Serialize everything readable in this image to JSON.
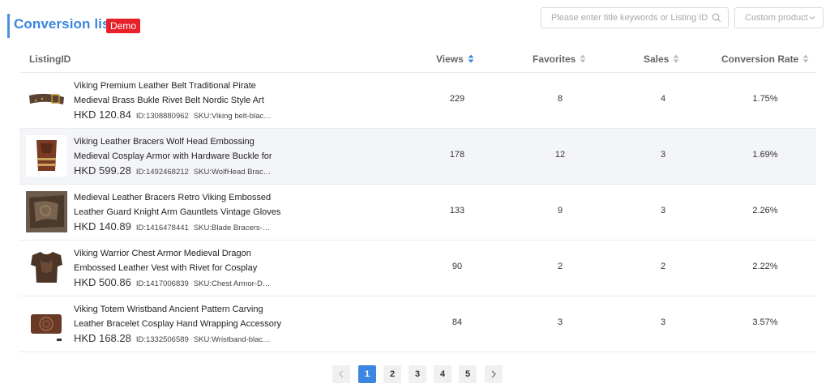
{
  "header": {
    "title": "Conversion list",
    "badge": "Demo",
    "search_placeholder": "Please enter title keywords or Listing ID",
    "select_value": "Custom product"
  },
  "columns": {
    "listing": "ListingID",
    "views": "Views",
    "favorites": "Favorites",
    "sales": "Sales",
    "conversion": "Conversion Rate"
  },
  "rows": [
    {
      "title": "Viking Premium Leather Belt Traditional Pirate Medieval Brass Bukle Rivet Belt Nordic Style Art Decor",
      "price": "HKD 120.84",
      "id": "ID:1308880962",
      "sku": "SKU:Viking belt-blac…",
      "views": "229",
      "favorites": "8",
      "sales": "4",
      "conversion": "1.75%"
    },
    {
      "title": "Viking Leather Bracers Wolf Head Embossing Medieval Cosplay Armor with Hardware Buckle for Cosplay",
      "price": "HKD 599.28",
      "id": "ID:1492468212",
      "sku": "SKU:WolfHead Brac…",
      "views": "178",
      "favorites": "12",
      "sales": "3",
      "conversion": "1.69%"
    },
    {
      "title": "Medieval Leather Bracers Retro Viking Embossed Leather Guard Knight Arm Gauntlets Vintage Gloves",
      "price": "HKD 140.89",
      "id": "ID:1416478441",
      "sku": "SKU:Blade Bracers-…",
      "views": "133",
      "favorites": "9",
      "sales": "3",
      "conversion": "2.26%"
    },
    {
      "title": "Viking Warrior Chest Armor Medieval Dragon Embossed Leather Vest with Rivet for Cosplay Burgundy",
      "price": "HKD 500.86",
      "id": "ID:1417006839",
      "sku": "SKU:Chest Armor-D…",
      "views": "90",
      "favorites": "2",
      "sales": "2",
      "conversion": "2.22%"
    },
    {
      "title": "Viking Totem Wristband Ancient Pattern Carving Leather Bracelet Cosplay Hand Wrapping Accessory",
      "price": "HKD 168.28",
      "id": "ID:1332506589",
      "sku": "SKU:Wristband-blac…",
      "views": "84",
      "favorites": "3",
      "sales": "3",
      "conversion": "3.57%"
    }
  ],
  "pagination": {
    "pages": [
      "1",
      "2",
      "3",
      "4",
      "5"
    ],
    "current": "1"
  },
  "colors": {
    "accent": "#3a86e0",
    "badge": "#e8202a"
  }
}
